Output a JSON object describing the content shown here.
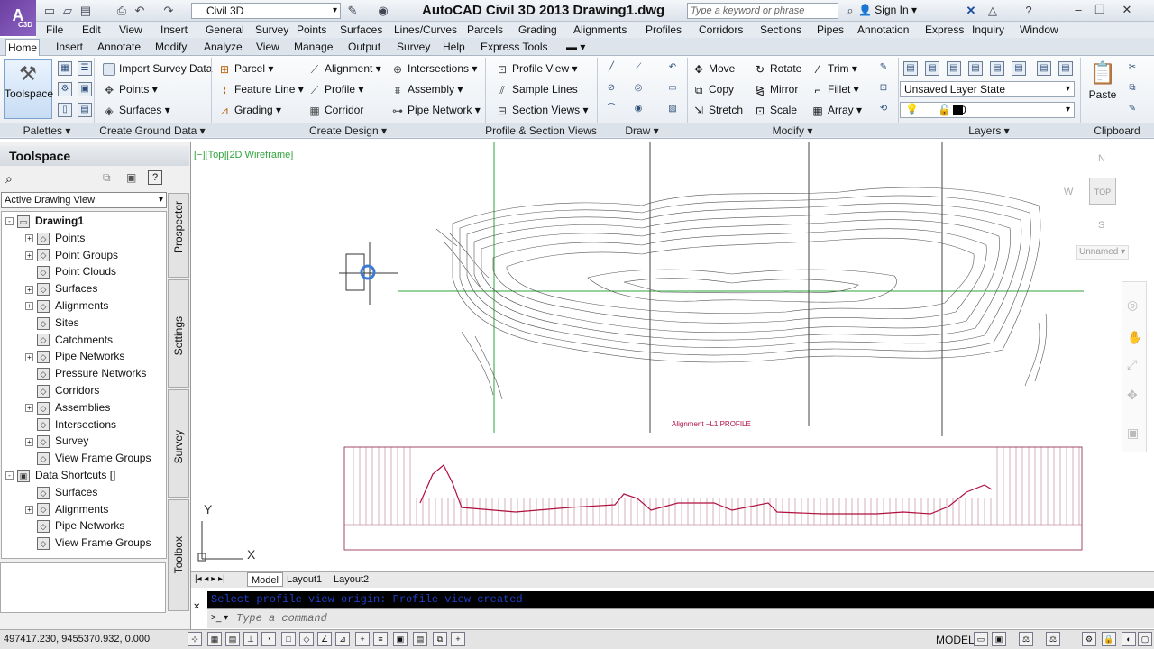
{
  "window": {
    "title": "AutoCAD Civil 3D 2013     Drawing1.dwg",
    "app_short": "C3D",
    "workspace": "Civil 3D",
    "search_placeholder": "Type a keyword or phrase",
    "sign_in": "Sign In"
  },
  "menubar": [
    "File",
    "Edit",
    "View",
    "Insert",
    "General",
    "Survey",
    "Points",
    "Surfaces",
    "Lines/Curves",
    "Parcels",
    "Grading",
    "Alignments",
    "Profiles",
    "Corridors",
    "Sections",
    "Pipes",
    "Annotation",
    "Express",
    "Inquiry",
    "Window"
  ],
  "ribbon_tabs": [
    "Home",
    "Insert",
    "Annotate",
    "Modify",
    "Analyze",
    "View",
    "Manage",
    "Output",
    "Survey",
    "Help",
    "Express Tools"
  ],
  "ribbon": {
    "palettes": {
      "label": "Palettes",
      "toolspace": "Toolspace"
    },
    "create_ground": {
      "label": "Create Ground Data",
      "items": [
        "Import Survey Data",
        "Points",
        "Surfaces"
      ]
    },
    "create_design": {
      "label": "Create Design",
      "items": [
        "Parcel",
        "Feature Line",
        "Grading",
        "Alignment",
        "Profile",
        "Corridor",
        "Intersections",
        "Assembly",
        "Pipe Network"
      ]
    },
    "profile_section": {
      "label": "Profile & Section Views",
      "items": [
        "Profile View",
        "Sample Lines",
        "Section Views"
      ]
    },
    "draw": {
      "label": "Draw"
    },
    "modify": {
      "label": "Modify",
      "items": [
        "Move",
        "Copy",
        "Stretch",
        "Rotate",
        "Mirror",
        "Scale",
        "Trim",
        "Fillet",
        "Array"
      ]
    },
    "layers": {
      "label": "Layers",
      "layer_state": "Unsaved Layer State",
      "current_layer": "0"
    },
    "clipboard": {
      "label": "Clipboard",
      "paste": "Paste"
    }
  },
  "toolspace": {
    "title": "Toolspace",
    "view_select": "Active Drawing View",
    "tabs": [
      "Prospector",
      "Settings",
      "Survey",
      "Toolbox"
    ],
    "tree": [
      {
        "label": "Drawing1",
        "level": 0,
        "exp": "-",
        "bold": true
      },
      {
        "label": "Points",
        "level": 1,
        "exp": "+"
      },
      {
        "label": "Point Groups",
        "level": 1,
        "exp": "+"
      },
      {
        "label": "Point Clouds",
        "level": 1,
        "exp": ""
      },
      {
        "label": "Surfaces",
        "level": 1,
        "exp": "+"
      },
      {
        "label": "Alignments",
        "level": 1,
        "exp": "+"
      },
      {
        "label": "Sites",
        "level": 1,
        "exp": ""
      },
      {
        "label": "Catchments",
        "level": 1,
        "exp": ""
      },
      {
        "label": "Pipe Networks",
        "level": 1,
        "exp": "+"
      },
      {
        "label": "Pressure Networks",
        "level": 1,
        "exp": ""
      },
      {
        "label": "Corridors",
        "level": 1,
        "exp": ""
      },
      {
        "label": "Assemblies",
        "level": 1,
        "exp": "+"
      },
      {
        "label": "Intersections",
        "level": 1,
        "exp": ""
      },
      {
        "label": "Survey",
        "level": 1,
        "exp": "+"
      },
      {
        "label": "View Frame Groups",
        "level": 1,
        "exp": ""
      },
      {
        "label": "Data Shortcuts []",
        "level": 0,
        "exp": "-"
      },
      {
        "label": "Surfaces",
        "level": 1,
        "exp": ""
      },
      {
        "label": "Alignments",
        "level": 1,
        "exp": "+"
      },
      {
        "label": "Pipe Networks",
        "level": 1,
        "exp": ""
      },
      {
        "label": "View Frame Groups",
        "level": 1,
        "exp": ""
      }
    ]
  },
  "drawing": {
    "viewport_label": "[−][Top][2D Wireframe]",
    "profile_title": "Alignment −L1 PROFILE",
    "viewcube": {
      "top": "TOP",
      "n": "N",
      "s": "S",
      "w": "W",
      "ucs": "Unnamed"
    },
    "ucs_y": "Y",
    "ucs_x": "X"
  },
  "layout_tabs": [
    "Model",
    "Layout1",
    "Layout2"
  ],
  "command": {
    "history": "Select profile view origin: Profile view created",
    "placeholder": "Type a command"
  },
  "status": {
    "coords": "497417.230, 9455370.932, 0.000",
    "model": "MODEL"
  },
  "colors": {
    "accent": "#6c3fa0",
    "crosshair": "#2fa43b",
    "profile_line": "#b01040",
    "command_text": "#1e3fc7"
  }
}
